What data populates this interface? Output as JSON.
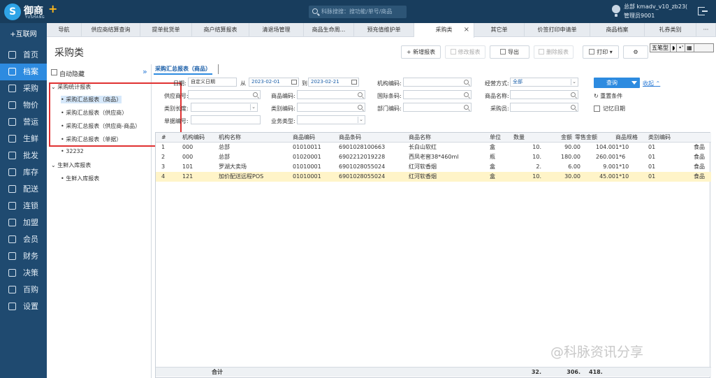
{
  "app": {
    "logo_name": "御商",
    "logo_sub": "YUSHANG",
    "search_placeholder": "科脉搜搜：搜功能/单号/商品",
    "user_line1": "总部  kmadv_v10_zb23(",
    "user_line2": "管理员9001"
  },
  "nav": {
    "brand": "+互联网",
    "items": [
      {
        "label": "首页",
        "icon": "home-icon",
        "active": false
      },
      {
        "label": "档案",
        "icon": "archive-icon",
        "active": true
      },
      {
        "label": "采购",
        "icon": "cart-icon",
        "active": false
      },
      {
        "label": "物价",
        "icon": "price-icon",
        "active": false
      },
      {
        "label": "营运",
        "icon": "chart-icon",
        "active": false
      },
      {
        "label": "生鲜",
        "icon": "fresh-icon",
        "active": false
      },
      {
        "label": "批发",
        "icon": "wholesale-icon",
        "active": false
      },
      {
        "label": "库存",
        "icon": "inventory-icon",
        "active": false
      },
      {
        "label": "配送",
        "icon": "delivery-icon",
        "active": false
      },
      {
        "label": "连锁",
        "icon": "chain-icon",
        "active": false
      },
      {
        "label": "加盟",
        "icon": "franchise-icon",
        "active": false
      },
      {
        "label": "会员",
        "icon": "member-icon",
        "active": false
      },
      {
        "label": "财务",
        "icon": "finance-icon",
        "active": false
      },
      {
        "label": "决策",
        "icon": "decision-icon",
        "active": false
      },
      {
        "label": "百购",
        "icon": "baigou-icon",
        "active": false
      },
      {
        "label": "设置",
        "icon": "settings-icon",
        "active": false
      }
    ]
  },
  "tabs": [
    "导航",
    "供应商结算查询",
    "提单批货单",
    "商户结算报表",
    "清退场管理",
    "商品生命周...",
    "预充值维护单",
    "采购类",
    "其它单",
    "价签打印申请单",
    "商品档案",
    "礼券类别",
    "···"
  ],
  "page": {
    "title": "采购类",
    "toolbar": {
      "new": "新增报表",
      "edit": "修改报表",
      "export": "导出",
      "delete": "删除报表",
      "print": "打印"
    },
    "ime": [
      "五笔型",
      "◗",
      "•'",
      "▦"
    ]
  },
  "tree": {
    "auto_label": "自动隐藏",
    "group1": "采购统计报表",
    "items1": [
      "采购汇总报表（商品）",
      "采购汇总报表（供应商）",
      "采购汇总报表（供应商-商品）",
      "采购汇总报表（单据）",
      "32232"
    ],
    "group2": "生鲜入库报表",
    "items2": [
      "生鲜入库报表"
    ]
  },
  "form": {
    "subtab": "采购汇总报表（商品）",
    "date_label": "日期:",
    "date_mode": "自定义日期",
    "from_label": "从",
    "from_value": "2023-02-01",
    "to_label": "到",
    "to_value": "2023-02-21",
    "org_code": "机构编码:",
    "op_mode": "经营方式:",
    "op_mode_value": "全部",
    "query": "查询",
    "collapse": "收起",
    "supplier": "供应商号:",
    "product_code": "商品编码:",
    "barcode": "国际条码:",
    "product_name": "商品名称:",
    "reset": "重置条件",
    "category_level": "类别长度:",
    "category_code": "类别编码:",
    "dept_code": "部门编码:",
    "buyer": "采购员:",
    "remember_date": "记忆日期",
    "doc_no": "单据编号:",
    "biz_type": "业务类型:"
  },
  "table": {
    "headers": [
      "#",
      "机构编码",
      "机构名称",
      "商品编码",
      "商品条码",
      "商品名称",
      "单位",
      "数量",
      "金额",
      "零售金额",
      "商品规格",
      "类别编码",
      ""
    ],
    "rows": [
      [
        "1",
        "000",
        "总部",
        "01010011",
        "6901028100663",
        "长白山软红",
        "盒",
        "10.",
        "90.00",
        "104.00",
        "1*10",
        "01",
        "食品"
      ],
      [
        "2",
        "000",
        "总部",
        "01020001",
        "6902212019228",
        "西凤老窖38*460ml",
        "瓶",
        "10.",
        "180.00",
        "260.00",
        "1*6",
        "01",
        "食品"
      ],
      [
        "3",
        "101",
        "罗湖大卖场",
        "01010001",
        "6901028055024",
        "红河软香烟",
        "盒",
        "2.",
        "6.00",
        "9.00",
        "1*10",
        "01",
        "食品"
      ],
      [
        "4",
        "121",
        "加价配送远程POS",
        "01010001",
        "6901028055024",
        "红河软香烟",
        "盒",
        "10.",
        "30.00",
        "45.00",
        "1*10",
        "01",
        "食品"
      ]
    ],
    "footer_label": "合计",
    "footer_qty": "32.",
    "footer_amount": "306.",
    "footer_retail": "418."
  },
  "watermark": "@科脉资讯分享",
  "colors": {
    "topbar": "#183d5d",
    "sidebar": "#1f4a70",
    "accent": "#2d8be0",
    "highlight": "#fff4c8",
    "annotation": "#e03131"
  }
}
